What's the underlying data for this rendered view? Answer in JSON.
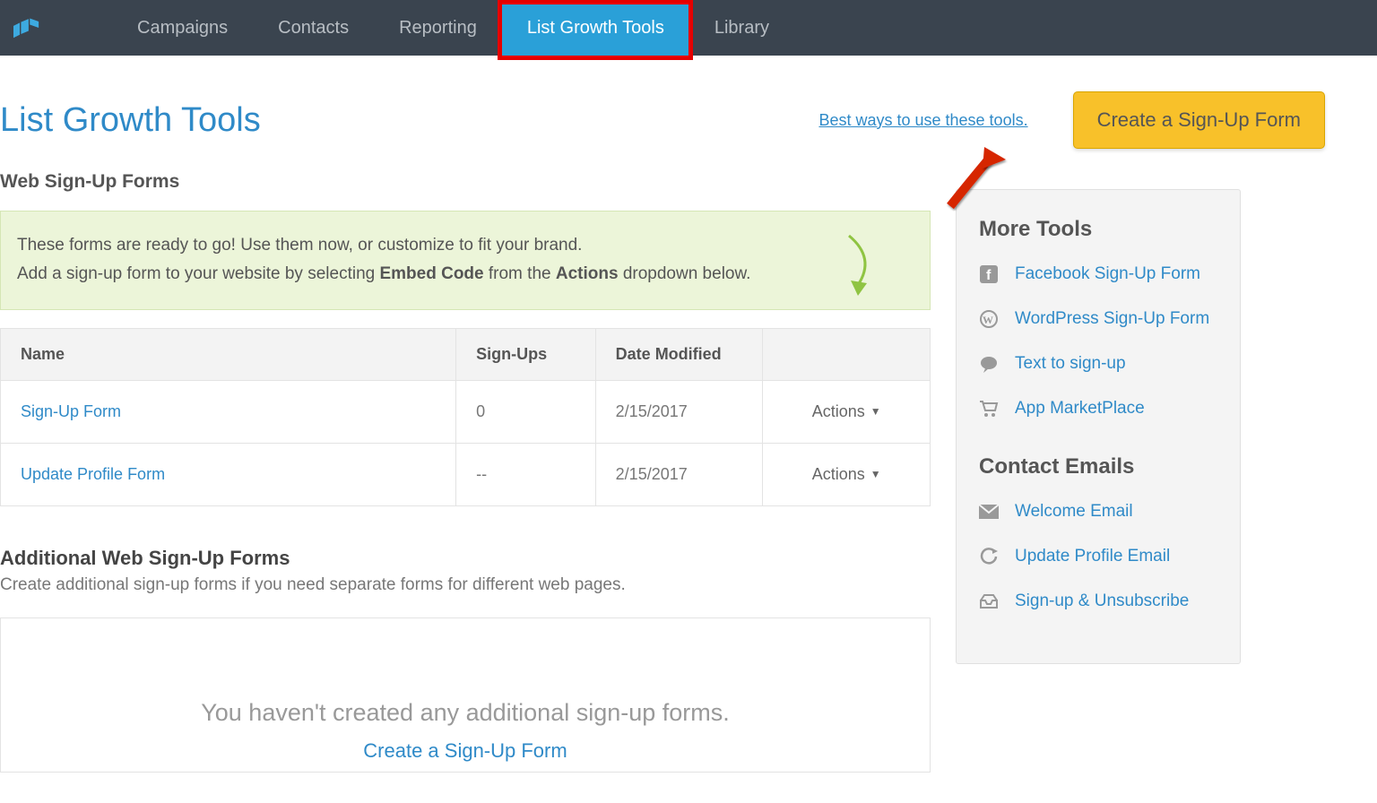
{
  "nav": {
    "items": [
      "Campaigns",
      "Contacts",
      "Reporting",
      "List Growth Tools",
      "Library"
    ],
    "activeIndex": 3
  },
  "page": {
    "title": "List Growth Tools",
    "helpLink": "Best ways to use these tools.",
    "createBtn": "Create a Sign-Up Form"
  },
  "webForms": {
    "heading": "Web Sign-Up Forms",
    "info1": "These forms are ready to go! Use them now, or customize to fit your brand.",
    "info2a": "Add a sign-up form to your website by selecting ",
    "info2b": "Embed Code",
    "info2c": " from the ",
    "info2d": "Actions",
    "info2e": " dropdown below.",
    "th": {
      "name": "Name",
      "signups": "Sign-Ups",
      "date": "Date Modified"
    },
    "rows": [
      {
        "name": "Sign-Up Form",
        "signups": "0",
        "date": "2/15/2017",
        "action": "Actions"
      },
      {
        "name": "Update Profile Form",
        "signups": "--",
        "date": "2/15/2017",
        "action": "Actions"
      }
    ]
  },
  "additional": {
    "heading": "Additional Web Sign-Up Forms",
    "sub": "Create additional sign-up forms if you need separate forms for different web pages.",
    "emptyText": "You haven't created any additional sign-up forms.",
    "emptyLink": "Create a Sign-Up Form"
  },
  "moreTools": {
    "heading": "More Tools",
    "items": [
      "Facebook Sign-Up Form",
      "WordPress Sign-Up Form",
      "Text to sign-up",
      "App MarketPlace"
    ]
  },
  "contactEmails": {
    "heading": "Contact Emails",
    "items": [
      "Welcome Email",
      "Update Profile Email",
      "Sign-up & Unsubscribe"
    ]
  }
}
